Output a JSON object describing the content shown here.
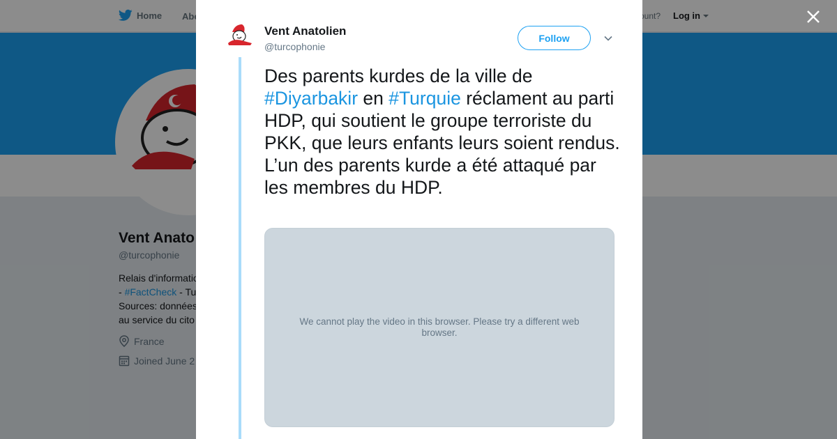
{
  "background": {
    "nav": {
      "home": "Home",
      "about": "Abo",
      "account": "ccount?",
      "login": "Log in"
    },
    "profile": {
      "name": "Vent Anato",
      "handle": "@turcophonie",
      "bio_line1": "Relais d'informatio",
      "bio_line2_prefix": "- ",
      "bio_hashtag": "#FactCheck",
      "bio_line2_suffix": " - Tu",
      "bio_line3": "Sources: données",
      "bio_line4": "au service du cito",
      "location": "France",
      "joined": "Joined June 2"
    }
  },
  "modal": {
    "author_name": "Vent Anatolien",
    "author_handle": "@turcophonie",
    "follow_label": "Follow",
    "tweet": {
      "t1": "Des parents kurdes de la ville de ",
      "h1": "#Diyarbakir",
      "t2": " en ",
      "h2": "#Turquie",
      "t3": " réclament au parti HDP, qui soutient le groupe terroriste du PKK, que leurs enfants leurs soient rendus. L’un des parents kurde a été attaqué par les membres du HDP."
    },
    "video_message": "We cannot play the video in this browser. Please try a different web browser."
  },
  "colors": {
    "accent": "#1da1f2",
    "hashtag": "#1b95e0",
    "thread_line": "#a9dcfa",
    "video_bg": "#ccd6dd"
  },
  "icons": [
    "twitter-bird-icon",
    "caret-down-icon",
    "location-pin-icon",
    "calendar-icon",
    "close-icon",
    "chevron-down-icon"
  ]
}
